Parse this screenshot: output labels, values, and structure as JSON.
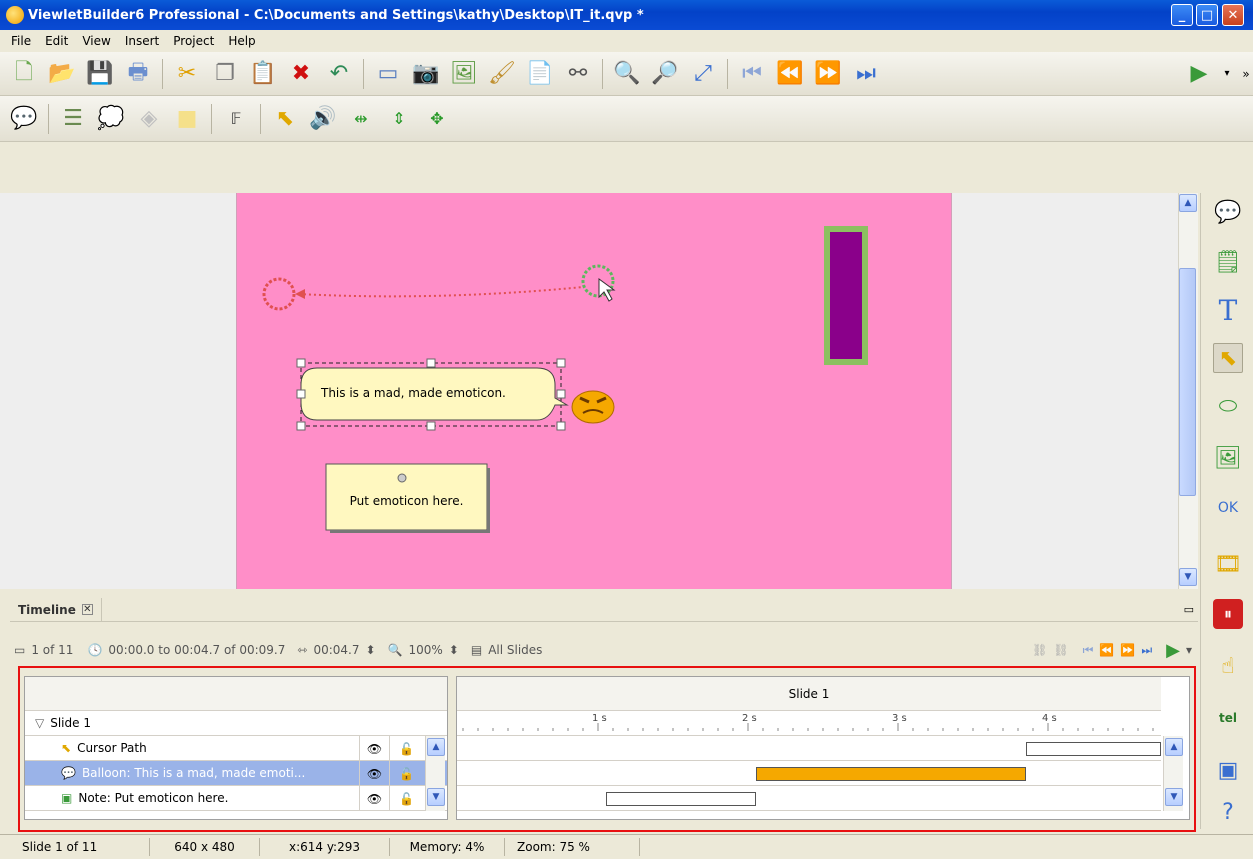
{
  "window": {
    "title": "ViewletBuilder6 Professional - C:\\Documents and Settings\\kathy\\Desktop\\IT_it.qvp *"
  },
  "menu": [
    "File",
    "Edit",
    "View",
    "Insert",
    "Project",
    "Help"
  ],
  "stage": {
    "balloon_text": "This is a mad, made emoticon.",
    "note_text": "Put emoticon here."
  },
  "timeline": {
    "tab_label": "Timeline",
    "slide_count": "1 of 11",
    "time_range": "00:00.0 to 00:04.7 of 00:09.7",
    "duration": "00:04.7",
    "zoom": "100%",
    "all_slides": "All Slides",
    "slide_header": "Slide 1",
    "ticks": [
      "1 s",
      "2 s",
      "3 s",
      "4 s"
    ],
    "slide_row": "Slide 1",
    "layers": [
      {
        "label": "Cursor Path"
      },
      {
        "label": "Balloon: This is a mad, made emoti..."
      },
      {
        "label": "Note: Put emoticon here."
      }
    ],
    "bars": [
      {
        "start_s": 3.85,
        "end_s": 4.75,
        "color": "#ffffff"
      },
      {
        "start_s": 2.05,
        "end_s": 3.85,
        "color": "#f5a800"
      },
      {
        "start_s": 1.05,
        "end_s": 2.05,
        "color": "#ffffff"
      }
    ]
  },
  "status": {
    "slide": "Slide 1 of 11",
    "size": "640 x 480",
    "coords": "x:614 y:293",
    "memory": "Memory: 4%",
    "zoom": "Zoom: 75 %"
  },
  "colors": {
    "stage_bg": "#ff8ec8",
    "balloon_bar": "#f5a800",
    "highlight_frame": "#e81010",
    "selected_row": "#9ab3e8"
  }
}
